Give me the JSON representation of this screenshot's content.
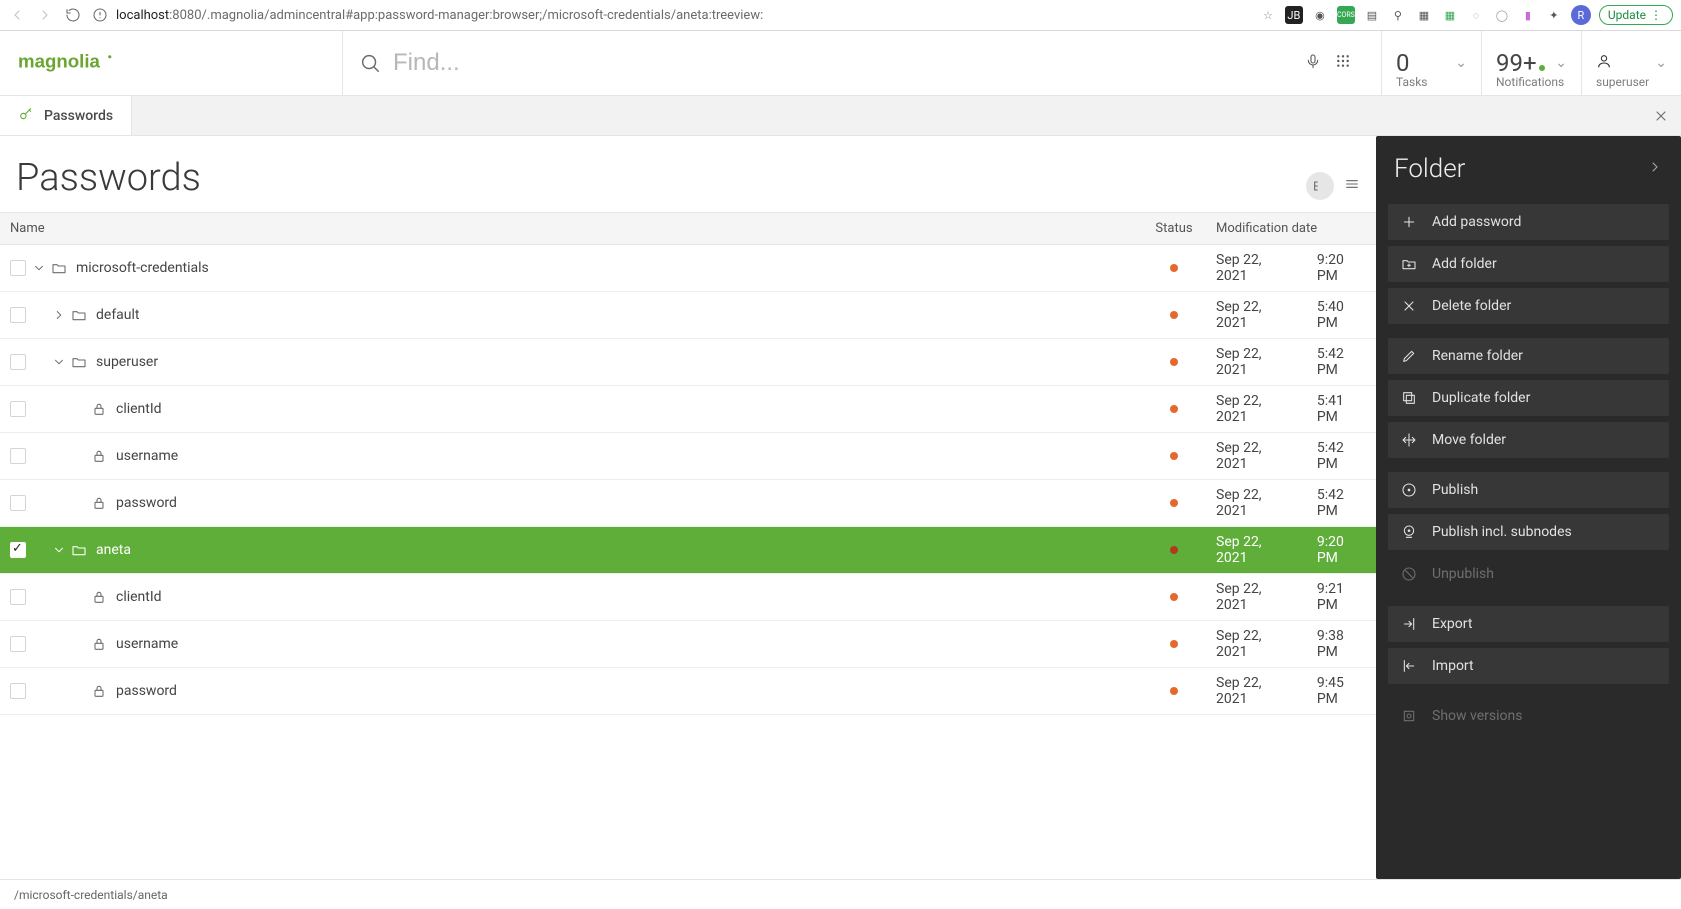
{
  "browser": {
    "url_host": "localhost",
    "url_port_path": ":8080/.magnolia/admincentral#app:password-manager:browser;/microsoft-credentials/aneta:treeview:",
    "update_label": "Update",
    "avatar_letter": "R"
  },
  "header": {
    "find_placeholder": "Find...",
    "tasks": {
      "count": "0",
      "label": "Tasks"
    },
    "notifications": {
      "count": "99+",
      "label": "Notifications"
    },
    "user_label": "superuser"
  },
  "tab": {
    "label": "Passwords"
  },
  "page": {
    "title": "Passwords"
  },
  "columns": {
    "name": "Name",
    "status": "Status",
    "date": "Modification date"
  },
  "rows": [
    {
      "indent": 0,
      "expand": "down",
      "icon": "folder",
      "name": "microsoft-credentials",
      "date": "Sep 22, 2021",
      "time": "9:20 PM",
      "selected": false,
      "checked": false
    },
    {
      "indent": 1,
      "expand": "right",
      "icon": "folder",
      "name": "default",
      "date": "Sep 22, 2021",
      "time": "5:40 PM",
      "selected": false,
      "checked": false
    },
    {
      "indent": 1,
      "expand": "down",
      "icon": "folder",
      "name": "superuser",
      "date": "Sep 22, 2021",
      "time": "5:42 PM",
      "selected": false,
      "checked": false
    },
    {
      "indent": 2,
      "expand": "none",
      "icon": "lock",
      "name": "clientId",
      "date": "Sep 22, 2021",
      "time": "5:41 PM",
      "selected": false,
      "checked": false
    },
    {
      "indent": 2,
      "expand": "none",
      "icon": "lock",
      "name": "username",
      "date": "Sep 22, 2021",
      "time": "5:42 PM",
      "selected": false,
      "checked": false
    },
    {
      "indent": 2,
      "expand": "none",
      "icon": "lock",
      "name": "password",
      "date": "Sep 22, 2021",
      "time": "5:42 PM",
      "selected": false,
      "checked": false
    },
    {
      "indent": 1,
      "expand": "down",
      "icon": "folder",
      "name": "aneta",
      "date": "Sep 22, 2021",
      "time": "9:20 PM",
      "selected": true,
      "checked": true
    },
    {
      "indent": 2,
      "expand": "none",
      "icon": "lock",
      "name": "clientId",
      "date": "Sep 22, 2021",
      "time": "9:21 PM",
      "selected": false,
      "checked": false
    },
    {
      "indent": 2,
      "expand": "none",
      "icon": "lock",
      "name": "username",
      "date": "Sep 22, 2021",
      "time": "9:38 PM",
      "selected": false,
      "checked": false
    },
    {
      "indent": 2,
      "expand": "none",
      "icon": "lock",
      "name": "password",
      "date": "Sep 22, 2021",
      "time": "9:45 PM",
      "selected": false,
      "checked": false
    }
  ],
  "side_panel": {
    "title": "Folder",
    "groups": [
      [
        {
          "icon": "plus",
          "label": "Add password",
          "disabled": false
        },
        {
          "icon": "folder-plus",
          "label": "Add folder",
          "disabled": false
        },
        {
          "icon": "x",
          "label": "Delete folder",
          "disabled": false
        }
      ],
      [
        {
          "icon": "pencil",
          "label": "Rename folder",
          "disabled": false
        },
        {
          "icon": "duplicate",
          "label": "Duplicate folder",
          "disabled": false
        },
        {
          "icon": "move",
          "label": "Move folder",
          "disabled": false
        }
      ],
      [
        {
          "icon": "info",
          "label": "Publish",
          "disabled": false
        },
        {
          "icon": "info-subs",
          "label": "Publish incl. subnodes",
          "disabled": false
        },
        {
          "icon": "unpublish",
          "label": "Unpublish",
          "disabled": true
        }
      ],
      [
        {
          "icon": "export",
          "label": "Export",
          "disabled": false
        },
        {
          "icon": "import",
          "label": "Import",
          "disabled": false
        }
      ],
      [
        {
          "icon": "versions",
          "label": "Show versions",
          "disabled": true
        }
      ]
    ]
  },
  "footer_path": "/microsoft-credentials/aneta"
}
